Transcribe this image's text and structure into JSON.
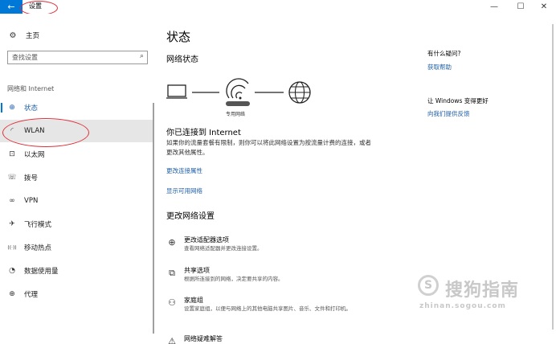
{
  "titlebar": {
    "back_icon": "back-arrow-icon",
    "title": "设置",
    "minimize": "—",
    "maximize": "☐",
    "close": "✕"
  },
  "sidebar": {
    "home": {
      "label": "主页",
      "icon": "gear-icon"
    },
    "search": {
      "placeholder": "查找设置",
      "icon": "search-icon"
    },
    "group_label": "网络和 Internet",
    "items": [
      {
        "label": "状态",
        "icon": "globe-icon",
        "glyph": "⊕",
        "active": true
      },
      {
        "label": "WLAN",
        "icon": "wifi-icon",
        "glyph": "◜",
        "selected": true
      },
      {
        "label": "以太网",
        "icon": "ethernet-icon",
        "glyph": "⊡"
      },
      {
        "label": "拨号",
        "icon": "dialup-icon",
        "glyph": "☏"
      },
      {
        "label": "VPN",
        "icon": "vpn-icon",
        "glyph": "∞"
      },
      {
        "label": "飞行模式",
        "icon": "airplane-icon",
        "glyph": "✈"
      },
      {
        "label": "移动热点",
        "icon": "hotspot-icon",
        "glyph": "((·))"
      },
      {
        "label": "数据使用量",
        "icon": "data-usage-icon",
        "glyph": "◔"
      },
      {
        "label": "代理",
        "icon": "proxy-icon",
        "glyph": "⊕"
      }
    ]
  },
  "main": {
    "title": "状态",
    "network_status_heading": "网络状态",
    "network_name": "专用网络",
    "connected_title": "你已连接到 Internet",
    "connected_desc": "如果你的流量套餐有限制，则你可以将此网络设置为按流量计费的连接，或者更改其他属性。",
    "link_change_props": "更改连接属性",
    "link_show_networks": "显示可用网络",
    "change_heading": "更改网络设置",
    "options": [
      {
        "title": "更改适配器选项",
        "desc": "查看网络适配器并更改连接设置。",
        "icon": "adapter-icon",
        "glyph": "⊕"
      },
      {
        "title": "共享选项",
        "desc": "根据所连接到的网络，决定要共享的内容。",
        "icon": "sharing-icon",
        "glyph": "⧉"
      },
      {
        "title": "家庭组",
        "desc": "设置家庭组，以便与网络上的其他电脑共享图片、音乐、文件和打印机。",
        "icon": "homegroup-icon",
        "glyph": "⚇"
      },
      {
        "title": "网络疑难解答",
        "desc": "",
        "icon": "warning-icon",
        "glyph": "⚠"
      }
    ]
  },
  "right": {
    "question_heading": "有什么疑问?",
    "get_help": "获取帮助",
    "improve_heading": "让 Windows 变得更好",
    "feedback": "向我们提供反馈"
  },
  "watermark": {
    "symbol": "S",
    "zh": "搜狗指南",
    "en": "zhinan.sogou.com"
  },
  "colors": {
    "accent": "#0078d7",
    "link": "#1f5fa8",
    "annotation": "#e0303a",
    "selected_bg": "#e6e6e6"
  }
}
